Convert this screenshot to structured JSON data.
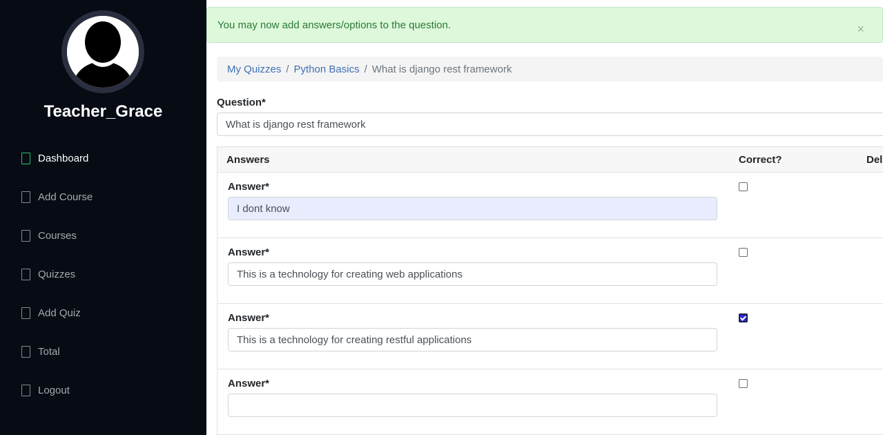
{
  "sidebar": {
    "username": "Teacher_Grace",
    "items": [
      {
        "label": "Dashboard",
        "icon": "dashboard-icon",
        "active": true
      },
      {
        "label": "Add Course",
        "icon": "add-course-icon"
      },
      {
        "label": "Courses",
        "icon": "courses-icon"
      },
      {
        "label": "Quizzes",
        "icon": "quizzes-icon"
      },
      {
        "label": "Add Quiz",
        "icon": "add-quiz-icon"
      },
      {
        "label": "Total",
        "icon": "total-icon"
      },
      {
        "label": "Logout",
        "icon": "logout-icon"
      }
    ]
  },
  "alert": {
    "message": "You may now add answers/options to the question.",
    "close": "×"
  },
  "breadcrumb": {
    "items": [
      "My Quizzes",
      "Python Basics",
      "What is django rest framework"
    ],
    "separator": "/"
  },
  "question": {
    "label": "Question*",
    "value": "What is django rest framework"
  },
  "answers": {
    "headers": {
      "answers": "Answers",
      "correct": "Correct?",
      "delete": "Dele"
    },
    "rows": [
      {
        "label": "Answer*",
        "value": "I dont know",
        "correct": false
      },
      {
        "label": "Answer*",
        "value": "This is a technology for creating web applications",
        "correct": false
      },
      {
        "label": "Answer*",
        "value": "This is a technology for creating restful applications",
        "correct": true
      },
      {
        "label": "Answer*",
        "value": "",
        "correct": false
      }
    ]
  },
  "colors": {
    "sidebar_bg": "#060b14",
    "alert_bg": "#ddf8db",
    "alert_text": "#2a7a36",
    "link": "#3f70b5",
    "active_icon": "#28c76f"
  }
}
